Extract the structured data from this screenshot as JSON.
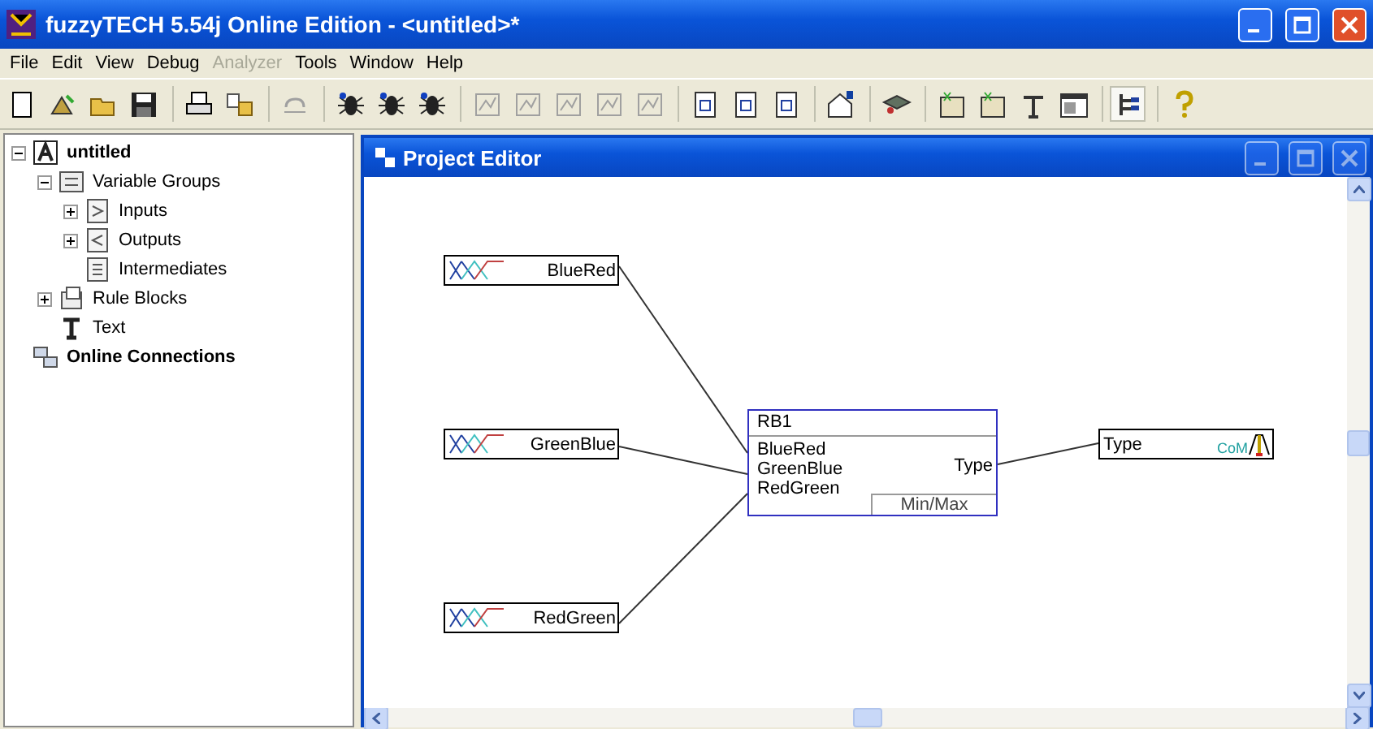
{
  "window": {
    "title": "fuzzyTECH 5.54j Online Edition - <untitled>*"
  },
  "menu": [
    {
      "label": "File",
      "disabled": false
    },
    {
      "label": "Edit",
      "disabled": false
    },
    {
      "label": "View",
      "disabled": false
    },
    {
      "label": "Debug",
      "disabled": false
    },
    {
      "label": "Analyzer",
      "disabled": true
    },
    {
      "label": "Tools",
      "disabled": false
    },
    {
      "label": "Window",
      "disabled": false
    },
    {
      "label": "Help",
      "disabled": false
    }
  ],
  "tree": [
    {
      "label": "untitled",
      "kind": "root",
      "expanded": true,
      "children": [
        {
          "label": "Variable Groups",
          "kind": "group",
          "expanded": true,
          "children": [
            {
              "label": "Inputs",
              "kind": "inputs",
              "expanded": false
            },
            {
              "label": "Outputs",
              "kind": "outputs",
              "expanded": false
            },
            {
              "label": "Intermediates",
              "kind": "intermediates"
            }
          ]
        },
        {
          "label": "Rule Blocks",
          "kind": "rules",
          "expanded": false
        },
        {
          "label": "Text",
          "kind": "text"
        }
      ]
    },
    {
      "label": "Online Connections",
      "kind": "online"
    }
  ],
  "editor": {
    "title": "Project Editor",
    "inputs": [
      {
        "label": "BlueRed"
      },
      {
        "label": "GreenBlue"
      },
      {
        "label": "RedGreen"
      }
    ],
    "rule_block": {
      "name": "RB1",
      "inputs": [
        "BlueRed",
        "GreenBlue",
        "RedGreen"
      ],
      "output": "Type",
      "operator": "Min/Max"
    },
    "output": {
      "label": "Type",
      "method": "CoM"
    }
  }
}
